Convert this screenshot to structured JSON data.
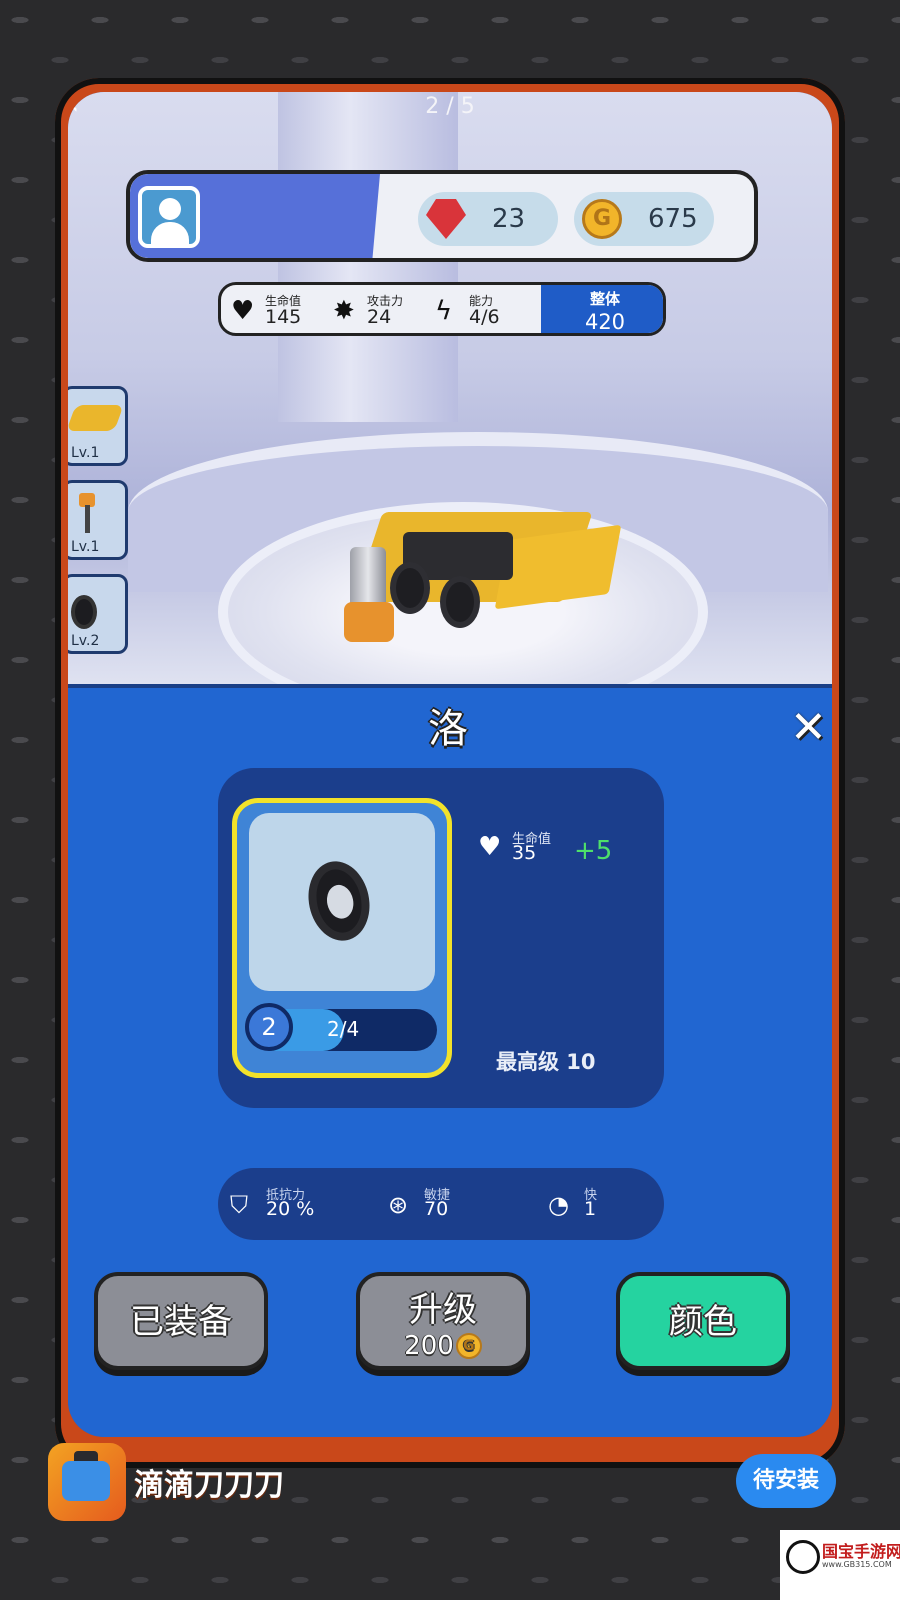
{
  "header": {
    "back_icon": "back-arrow-icon",
    "page_indicator": "2 / 5"
  },
  "profile": {
    "avatar_icon": "user-icon",
    "gems": "23",
    "coins": "675"
  },
  "stats": {
    "health_label": "生命值",
    "health_value": "145",
    "attack_label": "攻击力",
    "attack_value": "24",
    "power_label": "能力",
    "power_value": "4/6",
    "overall_label": "整体",
    "overall_value": "420"
  },
  "part_slots": [
    {
      "label": "Lv.1",
      "icon": "kart-body-icon"
    },
    {
      "label": "Lv.1",
      "icon": "hammer-icon"
    },
    {
      "label": "Lv.2",
      "icon": "wheel-icon"
    }
  ],
  "panel": {
    "title": "洛",
    "close_icon": "close-icon",
    "item": {
      "level": "2",
      "progress_text": "2/4",
      "progress": 0.5,
      "health_label": "生命值",
      "health_value": "35",
      "health_bonus": "+5",
      "max_level": "最高级 10"
    },
    "attributes": [
      {
        "label": "抵抗力",
        "value": "20 %",
        "icon": "shield-icon"
      },
      {
        "label": "敏捷",
        "value": "70",
        "icon": "steering-wheel-icon"
      },
      {
        "label": "快",
        "value": "1",
        "icon": "speedometer-icon"
      }
    ],
    "buttons": {
      "equipped": "已装备",
      "upgrade": "升级",
      "upgrade_price": "200",
      "color": "颜色"
    }
  },
  "ad": {
    "title": "滴滴刀刀刀",
    "install": "待安装"
  },
  "watermark": {
    "text": "国宝手游网",
    "url": "www.GB315.COM"
  }
}
